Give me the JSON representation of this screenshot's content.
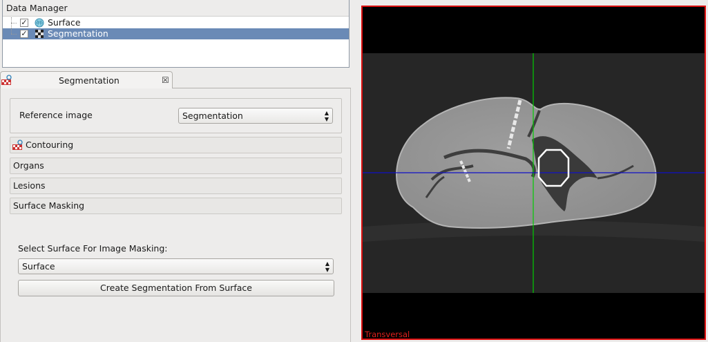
{
  "data_manager": {
    "title": "Data Manager",
    "nodes": [
      {
        "label": "Surface",
        "checked": true,
        "selected": false,
        "icon": "surface-icon"
      },
      {
        "label": "Segmentation",
        "checked": true,
        "selected": true,
        "icon": "segmentation-icon"
      }
    ]
  },
  "segmentation_panel": {
    "tab": {
      "label": "Segmentation",
      "close": "☒",
      "icon": "segmentation-plugin-icon"
    },
    "reference_image": {
      "label": "Reference image",
      "value": "Segmentation"
    },
    "sections": [
      {
        "label": "Contouring",
        "icon": "contouring-icon"
      },
      {
        "label": "Organs"
      },
      {
        "label": "Lesions"
      },
      {
        "label": "Surface Masking"
      }
    ],
    "surface_masking": {
      "select_label": "Select Surface For Image Masking:",
      "select_value": "Surface",
      "create_button": "Create Segmentation From Surface"
    }
  },
  "render_window": {
    "view_label": "Transversal",
    "border_color": "#dd1111",
    "crosshair": {
      "vertical_color": "#00cc00",
      "horizontal_color": "#1010c8"
    }
  }
}
